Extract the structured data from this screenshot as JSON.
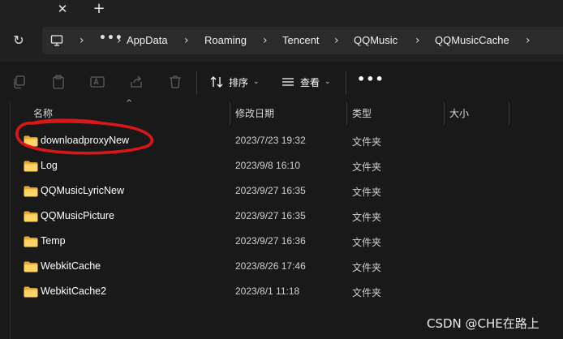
{
  "tabstrip": {
    "close_glyph": "✕",
    "new_glyph": "+"
  },
  "nav": {
    "refresh_glyph": "↻",
    "more_glyph": "•••",
    "separator": "›",
    "breadcrumbs": [
      "AppData",
      "Roaming",
      "Tencent",
      "QQMusic",
      "QQMusicCache"
    ]
  },
  "toolbar": {
    "sort_label": "排序",
    "view_label": "查看",
    "chevron": "⌄",
    "more_glyph": "•••",
    "icons": [
      "copy-icon",
      "paste-icon",
      "rename-icon",
      "share-icon",
      "delete-icon",
      "sort-icon",
      "view-icon"
    ]
  },
  "columns": {
    "name": "名称",
    "date": "修改日期",
    "type": "类型",
    "size": "大小"
  },
  "files": [
    {
      "name": "downloadproxyNew",
      "date": "2023/7/23 19:32",
      "type": "文件夹"
    },
    {
      "name": "Log",
      "date": "2023/9/8 16:10",
      "type": "文件夹"
    },
    {
      "name": "QQMusicLyricNew",
      "date": "2023/9/27 16:35",
      "type": "文件夹"
    },
    {
      "name": "QQMusicPicture",
      "date": "2023/9/27 16:35",
      "type": "文件夹"
    },
    {
      "name": "Temp",
      "date": "2023/9/27 16:36",
      "type": "文件夹"
    },
    {
      "name": "WebkitCache",
      "date": "2023/8/26 17:46",
      "type": "文件夹"
    },
    {
      "name": "WebkitCache2",
      "date": "2023/8/1 11:18",
      "type": "文件夹"
    }
  ],
  "watermark": "CSDN @CHE在路上",
  "colors": {
    "background": "#191919",
    "chrome": "#202020",
    "folder": "#f5c04a",
    "annotation": "#d81818"
  }
}
